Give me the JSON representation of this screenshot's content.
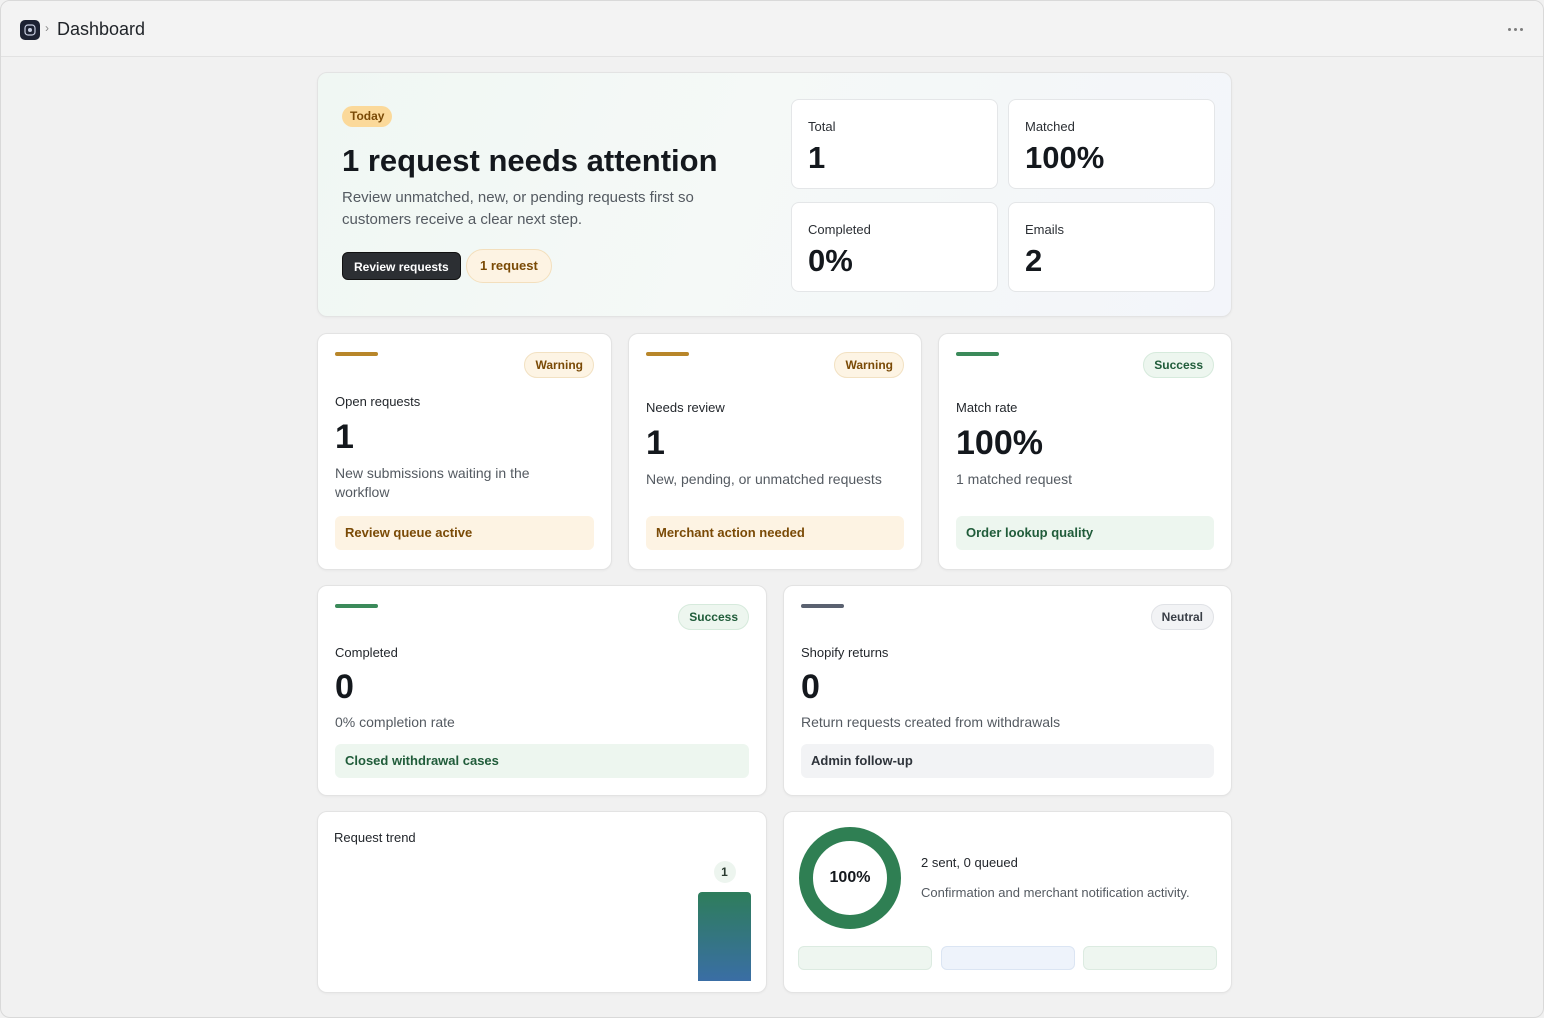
{
  "header": {
    "title": "Dashboard",
    "logo_icon": "app-logo-icon",
    "more_icon": "more-horizontal-icon"
  },
  "hero": {
    "badge": "Today",
    "title": "1 request needs attention",
    "description": "Review unmatched, new, or pending requests first so customers receive a clear next step.",
    "primary_button": "Review requests",
    "count_pill": "1 request",
    "stats": [
      {
        "label": "Total",
        "value": "1"
      },
      {
        "label": "Matched",
        "value": "100%"
      },
      {
        "label": "Completed",
        "value": "0%"
      },
      {
        "label": "Emails",
        "value": "2"
      }
    ]
  },
  "metrics": [
    {
      "status": "Warning",
      "label": "Open requests",
      "value": "1",
      "description": "New submissions waiting in the workflow",
      "footer": "Review queue active"
    },
    {
      "status": "Warning",
      "label": "Needs review",
      "value": "1",
      "description": "New, pending, or unmatched requests",
      "footer": "Merchant action needed"
    },
    {
      "status": "Success",
      "label": "Match rate",
      "value": "100%",
      "description": "1 matched request",
      "footer": "Order lookup quality"
    },
    {
      "status": "Success",
      "label": "Completed",
      "value": "0",
      "description": "0% completion rate",
      "footer": "Closed withdrawal cases"
    },
    {
      "status": "Neutral",
      "label": "Shopify returns",
      "value": "0",
      "description": "Return requests created from withdrawals",
      "footer": "Admin follow-up"
    }
  ],
  "trend": {
    "title": "Request trend",
    "chart_data": {
      "type": "bar",
      "categories": [
        ""
      ],
      "values": [
        1
      ],
      "title": "Request trend",
      "ylim": [
        0,
        1
      ]
    }
  },
  "emails": {
    "percent": "100%",
    "percent_value": 100,
    "summary": "2 sent, 0 queued",
    "description": "Confirmation and merchant notification activity."
  },
  "colors": {
    "warning": "#b8862a",
    "success": "#3b8a5a",
    "neutral": "#5a6170",
    "primary": "#2c2f33"
  }
}
